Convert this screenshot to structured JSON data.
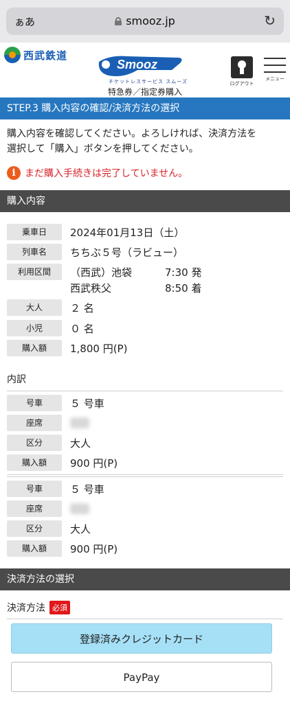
{
  "browser": {
    "text_size_label": "ぁあ",
    "domain": "smooz.jp"
  },
  "header": {
    "railway_name": "西武鉄道",
    "service_logo": "Smooz",
    "service_tagline": "チケットレスサービス スムーズ",
    "ticket_type": "特急券／指定券購入",
    "logout_label": "ログアウト",
    "menu_label": "メニュー"
  },
  "step": {
    "title": "STEP.3 購入内容の確認/決済方法の選択"
  },
  "intro": {
    "line1": "購入内容を確認してください。よろしければ、決済方法を",
    "line2": "選択して「購入」ボタンを押してください。",
    "warning": "まだ購入手続きは完了していません。"
  },
  "purchase": {
    "section_title": "購入内容",
    "date_label": "乗車日",
    "date_value": "2024年01月13日（土）",
    "train_label": "列車名",
    "train_value": "ちちぶ５号（ラビュー）",
    "route_label": "利用区間",
    "from_station": "（西武）池袋",
    "from_time": "7:30 発",
    "to_station": "西武秩父",
    "to_time": "8:50 着",
    "adult_label": "大人",
    "adult_value": "２ 名",
    "child_label": "小児",
    "child_value": "０ 名",
    "amount_label": "購入額",
    "amount_value": "1,800 円(P)"
  },
  "breakdown": {
    "title": "内訳",
    "items": [
      {
        "car_label": "号車",
        "car_value": "５ 号車",
        "seat_label": "座席",
        "type_label": "区分",
        "type_value": "大人",
        "amount_label": "購入額",
        "amount_value": "900 円(P)"
      },
      {
        "car_label": "号車",
        "car_value": "５ 号車",
        "seat_label": "座席",
        "type_label": "区分",
        "type_value": "大人",
        "amount_label": "購入額",
        "amount_value": "900 円(P)"
      }
    ]
  },
  "payment": {
    "section_title": "決済方法の選択",
    "label": "決済方法",
    "required": "必須",
    "options": [
      "登録済みクレジットカード",
      "PayPay"
    ]
  }
}
